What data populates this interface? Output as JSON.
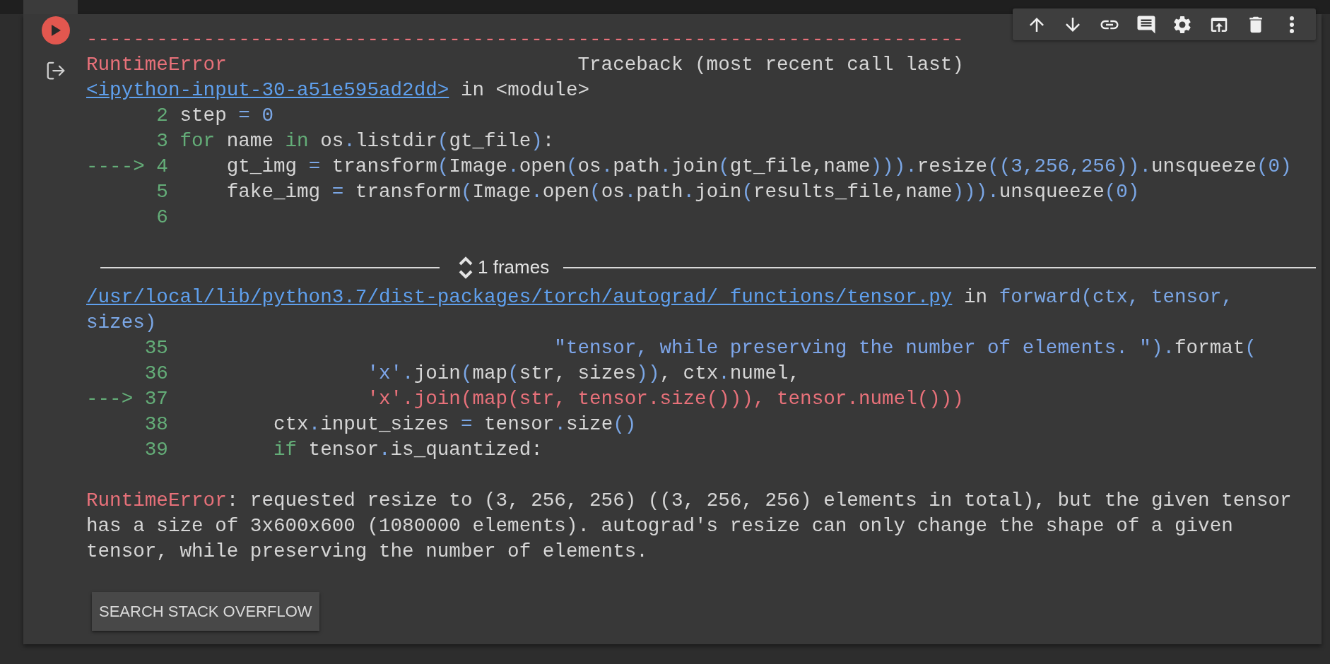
{
  "toolbar": {
    "buttons": [
      {
        "kind": "up"
      },
      {
        "kind": "down"
      },
      {
        "kind": "link"
      },
      {
        "kind": "comment"
      },
      {
        "kind": "settings"
      },
      {
        "kind": "mirror"
      },
      {
        "kind": "delete"
      },
      {
        "kind": "more"
      }
    ]
  },
  "traceback": {
    "rule": "---------------------------------------------------------------------------",
    "error_type": "RuntimeError",
    "title": "Traceback (most recent call last)"
  },
  "frames": [
    {
      "file": "<ipython-input-30-a51e595ad2dd>",
      "in_text": "in",
      "scope": {
        "text": "<module>",
        "kind": "p"
      },
      "lines": [
        {
          "number": "2",
          "tokens": [
            {
              "kind": "p",
              "text": "step "
            },
            {
              "kind": "o",
              "text": "="
            },
            {
              "kind": "o",
              "text": " 0"
            }
          ]
        },
        {
          "number": "3",
          "tokens": [
            {
              "kind": "k",
              "text": "for"
            },
            {
              "kind": "p",
              "text": " name "
            },
            {
              "kind": "k",
              "text": "in"
            },
            {
              "kind": "p",
              "text": " os"
            },
            {
              "kind": "o",
              "text": "."
            },
            {
              "kind": "p",
              "text": "listdir"
            },
            {
              "kind": "o",
              "text": "("
            },
            {
              "kind": "p",
              "text": "gt_file"
            },
            {
              "kind": "o",
              "text": ")"
            },
            {
              "kind": "p",
              "text": ":"
            }
          ]
        },
        {
          "number": "4",
          "arrow": "---->",
          "tokens": [
            {
              "kind": "p",
              "text": "    gt_img "
            },
            {
              "kind": "o",
              "text": "="
            },
            {
              "kind": "p",
              "text": " transform"
            },
            {
              "kind": "o",
              "text": "("
            },
            {
              "kind": "p",
              "text": "Image"
            },
            {
              "kind": "o",
              "text": "."
            },
            {
              "kind": "p",
              "text": "open"
            },
            {
              "kind": "o",
              "text": "("
            },
            {
              "kind": "p",
              "text": "os"
            },
            {
              "kind": "o",
              "text": "."
            },
            {
              "kind": "p",
              "text": "path"
            },
            {
              "kind": "o",
              "text": "."
            },
            {
              "kind": "p",
              "text": "join"
            },
            {
              "kind": "o",
              "text": "("
            },
            {
              "kind": "p",
              "text": "gt_file,name"
            },
            {
              "kind": "o",
              "text": ")))"
            },
            {
              "kind": "o",
              "text": "."
            },
            {
              "kind": "p",
              "text": "resize"
            },
            {
              "kind": "o",
              "text": "((3,256,256))"
            },
            {
              "kind": "o",
              "text": "."
            },
            {
              "kind": "p",
              "text": "unsqueeze"
            },
            {
              "kind": "o",
              "text": "(0)"
            }
          ]
        },
        {
          "number": "5",
          "tokens": [
            {
              "kind": "p",
              "text": "    fake_img "
            },
            {
              "kind": "o",
              "text": "="
            },
            {
              "kind": "p",
              "text": " transform"
            },
            {
              "kind": "o",
              "text": "("
            },
            {
              "kind": "p",
              "text": "Image"
            },
            {
              "kind": "o",
              "text": "."
            },
            {
              "kind": "p",
              "text": "open"
            },
            {
              "kind": "o",
              "text": "("
            },
            {
              "kind": "p",
              "text": "os"
            },
            {
              "kind": "o",
              "text": "."
            },
            {
              "kind": "p",
              "text": "path"
            },
            {
              "kind": "o",
              "text": "."
            },
            {
              "kind": "p",
              "text": "join"
            },
            {
              "kind": "o",
              "text": "("
            },
            {
              "kind": "p",
              "text": "results_file,name"
            },
            {
              "kind": "o",
              "text": ")))"
            },
            {
              "kind": "o",
              "text": "."
            },
            {
              "kind": "p",
              "text": "unsqueeze"
            },
            {
              "kind": "o",
              "text": "(0)"
            }
          ]
        },
        {
          "number": "6"
        }
      ],
      "collapsed": {
        "label": "1 frames"
      }
    },
    {
      "file": "/usr/local/lib/python3.7/dist-packages/torch/autograd/_functions/tensor.py",
      "in_text": "in",
      "scope": {
        "text": "forward(ctx, tensor, sizes)",
        "kind": "o"
      },
      "lines": [
        {
          "number": "35",
          "tokens": [
            {
              "kind": "s",
              "text": "                                \"tensor, while preserving the number of elements. \""
            },
            {
              "kind": "o",
              "text": ")."
            },
            {
              "kind": "p",
              "text": "format"
            },
            {
              "kind": "o",
              "text": "("
            }
          ]
        },
        {
          "number": "36",
          "tokens": [
            {
              "kind": "s",
              "text": "                'x'"
            },
            {
              "kind": "o",
              "text": "."
            },
            {
              "kind": "p",
              "text": "join"
            },
            {
              "kind": "o",
              "text": "("
            },
            {
              "kind": "p",
              "text": "map"
            },
            {
              "kind": "o",
              "text": "("
            },
            {
              "kind": "p",
              "text": "str, sizes"
            },
            {
              "kind": "o",
              "text": "))"
            },
            {
              "kind": "p",
              "text": ", ctx"
            },
            {
              "kind": "o",
              "text": "."
            },
            {
              "kind": "p",
              "text": "numel,"
            }
          ]
        },
        {
          "number": "37",
          "arrow": "--->",
          "tokens": [
            {
              "kind": "e",
              "text": "                'x'.join(map(str, tensor.size())), tensor.numel()))"
            }
          ]
        },
        {
          "number": "38",
          "tokens": [
            {
              "kind": "p",
              "text": "        ctx"
            },
            {
              "kind": "o",
              "text": "."
            },
            {
              "kind": "p",
              "text": "input_sizes "
            },
            {
              "kind": "o",
              "text": "="
            },
            {
              "kind": "p",
              "text": " tensor"
            },
            {
              "kind": "o",
              "text": "."
            },
            {
              "kind": "p",
              "text": "size"
            },
            {
              "kind": "o",
              "text": "()"
            }
          ]
        },
        {
          "number": "39",
          "tokens": [
            {
              "kind": "k",
              "text": "        if"
            },
            {
              "kind": "p",
              "text": " tensor"
            },
            {
              "kind": "o",
              "text": "."
            },
            {
              "kind": "p",
              "text": "is_quantized:"
            }
          ]
        }
      ]
    }
  ],
  "error": {
    "type": "RuntimeError",
    "message": ": requested resize to (3, 256, 256) ((3, 256, 256) elements in total), but the given tensor has a size of 3x600x600 (1080000 elements). autograd's resize can only change the shape of a given tensor, while preserving the number of elements."
  },
  "search_button": {
    "label": "SEARCH STACK OVERFLOW"
  }
}
